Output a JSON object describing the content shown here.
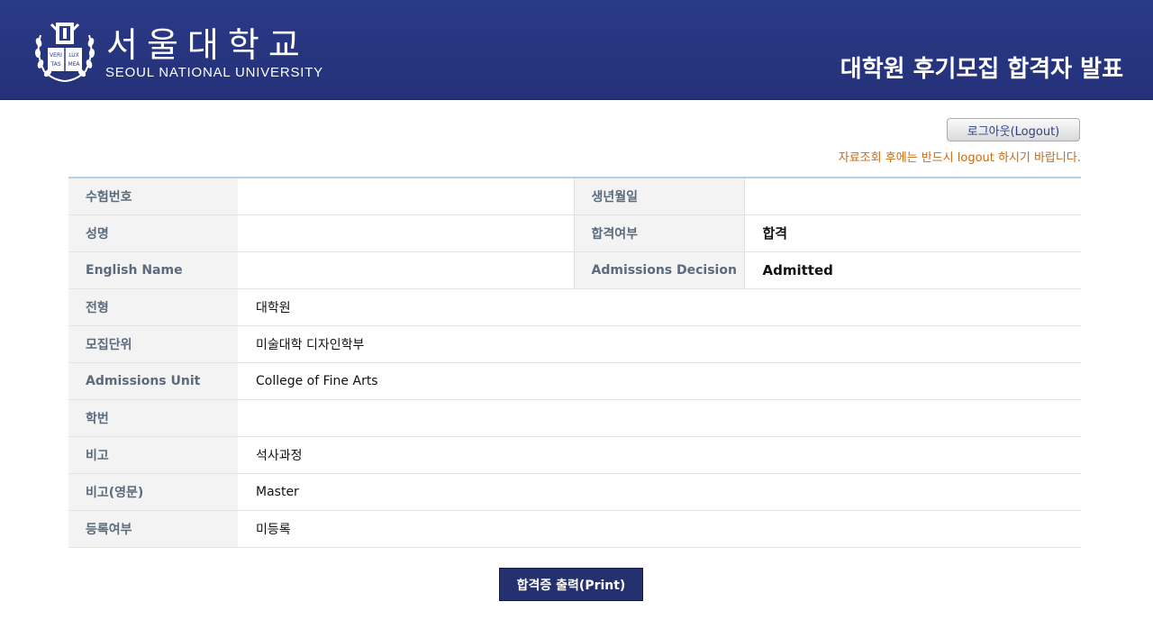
{
  "header": {
    "logo_kr": "서울대학교",
    "logo_en": "SEOUL NATIONAL UNIVERSITY",
    "logo_emblem_text": [
      "VERI",
      "LUX",
      "TAS",
      "MEA"
    ],
    "page_title": "대학원 후기모집 합격자 발표",
    "bg_color": "#24317a"
  },
  "logout": {
    "label": "로그아웃(Logout)",
    "notice": "자료조회 후에는 반드시 logout 하시기 바랍니다."
  },
  "table": {
    "exam_number": {
      "label": "수험번호",
      "value": ""
    },
    "birth_date": {
      "label": "생년월일",
      "value": ""
    },
    "name": {
      "label": "성명",
      "value": ""
    },
    "result": {
      "label": "합격여부",
      "value": "합격"
    },
    "english_name": {
      "label": "English Name",
      "value": ""
    },
    "admissions_decision": {
      "label": "Admissions Decision",
      "value": "Admitted"
    },
    "admission_type": {
      "label": "전형",
      "value": "대학원"
    },
    "recruit_unit": {
      "label": "모집단위",
      "value": "미술대학 디자인학부"
    },
    "admissions_unit": {
      "label": "Admissions Unit",
      "value": "College of Fine Arts"
    },
    "student_id": {
      "label": "학번",
      "value": ""
    },
    "remarks": {
      "label": "비고",
      "value": "석사과정"
    },
    "remarks_en": {
      "label": "비고(영문)",
      "value": "Master"
    },
    "registration": {
      "label": "등록여부",
      "value": "미등록"
    }
  },
  "print_button": {
    "label": "합격증 출력(Print)"
  }
}
